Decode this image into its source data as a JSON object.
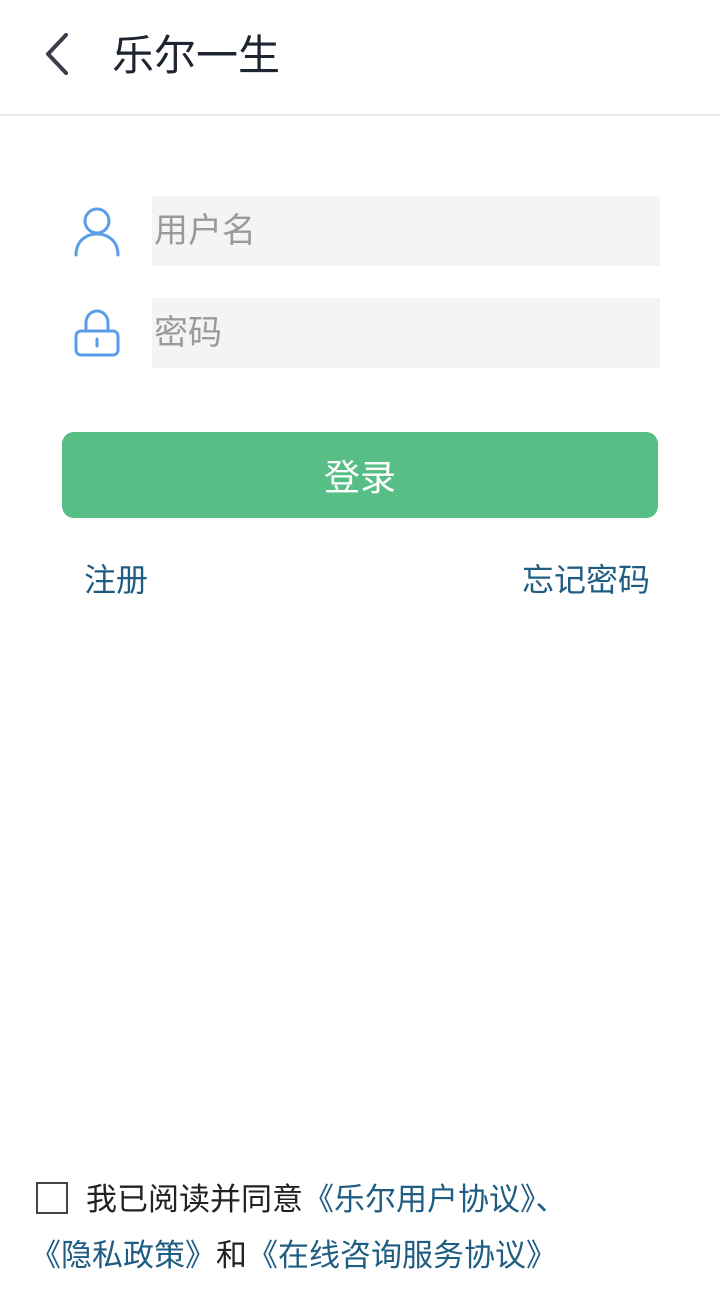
{
  "header": {
    "title": "乐尔一生"
  },
  "form": {
    "username_placeholder": "用户名",
    "password_placeholder": "密码",
    "login_label": "登录"
  },
  "links": {
    "register": "注册",
    "forgot_password": "忘记密码"
  },
  "agreement": {
    "prefix": "我已阅读并同意",
    "user_agreement": "《乐尔用户协议》",
    "separator": "、",
    "privacy_policy": "《隐私政策》",
    "conjunction": "和",
    "consult_agreement": "《在线咨询服务协议》"
  },
  "colors": {
    "accent_green": "#57bf86",
    "link_blue": "#1f5d82",
    "icon_blue": "#5b9ee8"
  },
  "icons": {
    "back": "chevron-left-icon",
    "user": "user-icon",
    "lock": "lock-icon"
  }
}
